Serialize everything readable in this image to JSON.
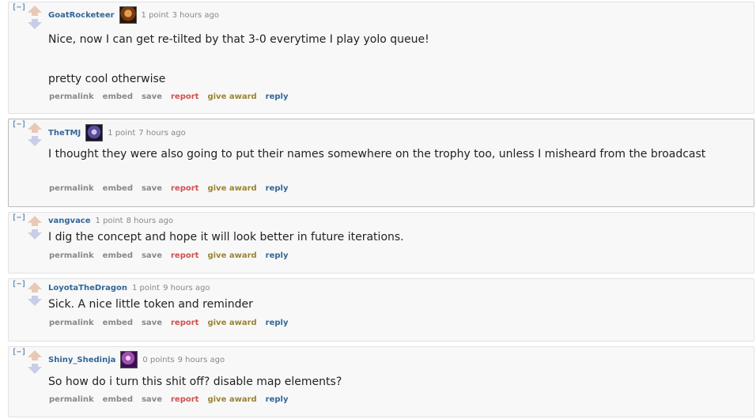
{
  "comments": [
    {
      "collapse": "[−]",
      "author": "GoatRocketeer",
      "score": "1 point",
      "time": "3 hours ago",
      "body": [
        "Nice, now I can get re-tilted by that 3-0 everytime I play yolo queue!",
        "pretty cool otherwise"
      ],
      "buttons": {
        "permalink": "permalink",
        "embed": "embed",
        "save": "save",
        "report": "report",
        "award": "give award",
        "reply": "reply"
      }
    },
    {
      "collapse": "[−]",
      "author": "TheTMJ",
      "score": "1 point",
      "time": "7 hours ago",
      "body": [
        "I thought they were also going to put their names somewhere on the trophy too, unless I misheard from the broadcast"
      ],
      "buttons": {
        "permalink": "permalink",
        "embed": "embed",
        "save": "save",
        "report": "report",
        "award": "give award",
        "reply": "reply"
      }
    },
    {
      "collapse": "[−]",
      "author": "vangvace",
      "score": "1 point",
      "time": "8 hours ago",
      "body": [
        "I dig the concept and hope it will look better in future iterations."
      ],
      "buttons": {
        "permalink": "permalink",
        "embed": "embed",
        "save": "save",
        "report": "report",
        "award": "give award",
        "reply": "reply"
      }
    },
    {
      "collapse": "[−]",
      "author": "LoyotaTheDragon",
      "score": "1 point",
      "time": "9 hours ago",
      "body": [
        "Sick. A nice little token and reminder"
      ],
      "buttons": {
        "permalink": "permalink",
        "embed": "embed",
        "save": "save",
        "report": "report",
        "award": "give award",
        "reply": "reply"
      }
    },
    {
      "collapse": "[−]",
      "author": "Shiny_Shedinja",
      "score": "0 points",
      "time": "9 hours ago",
      "body": [
        "So how do i turn this shit off? disable map elements?"
      ],
      "buttons": {
        "permalink": "permalink",
        "embed": "embed",
        "save": "save",
        "report": "report",
        "award": "give award",
        "reply": "reply"
      }
    }
  ],
  "colors": {
    "author": "#336699",
    "report": "#d05050",
    "award": "#9a8430",
    "reply": "#336699",
    "upvote": "#e8c9b7",
    "downvote": "#c9cde8"
  },
  "icons": {
    "upvote": "upvote-arrow-icon",
    "downvote": "downvote-arrow-icon",
    "flair": "user-flair-avatar"
  }
}
